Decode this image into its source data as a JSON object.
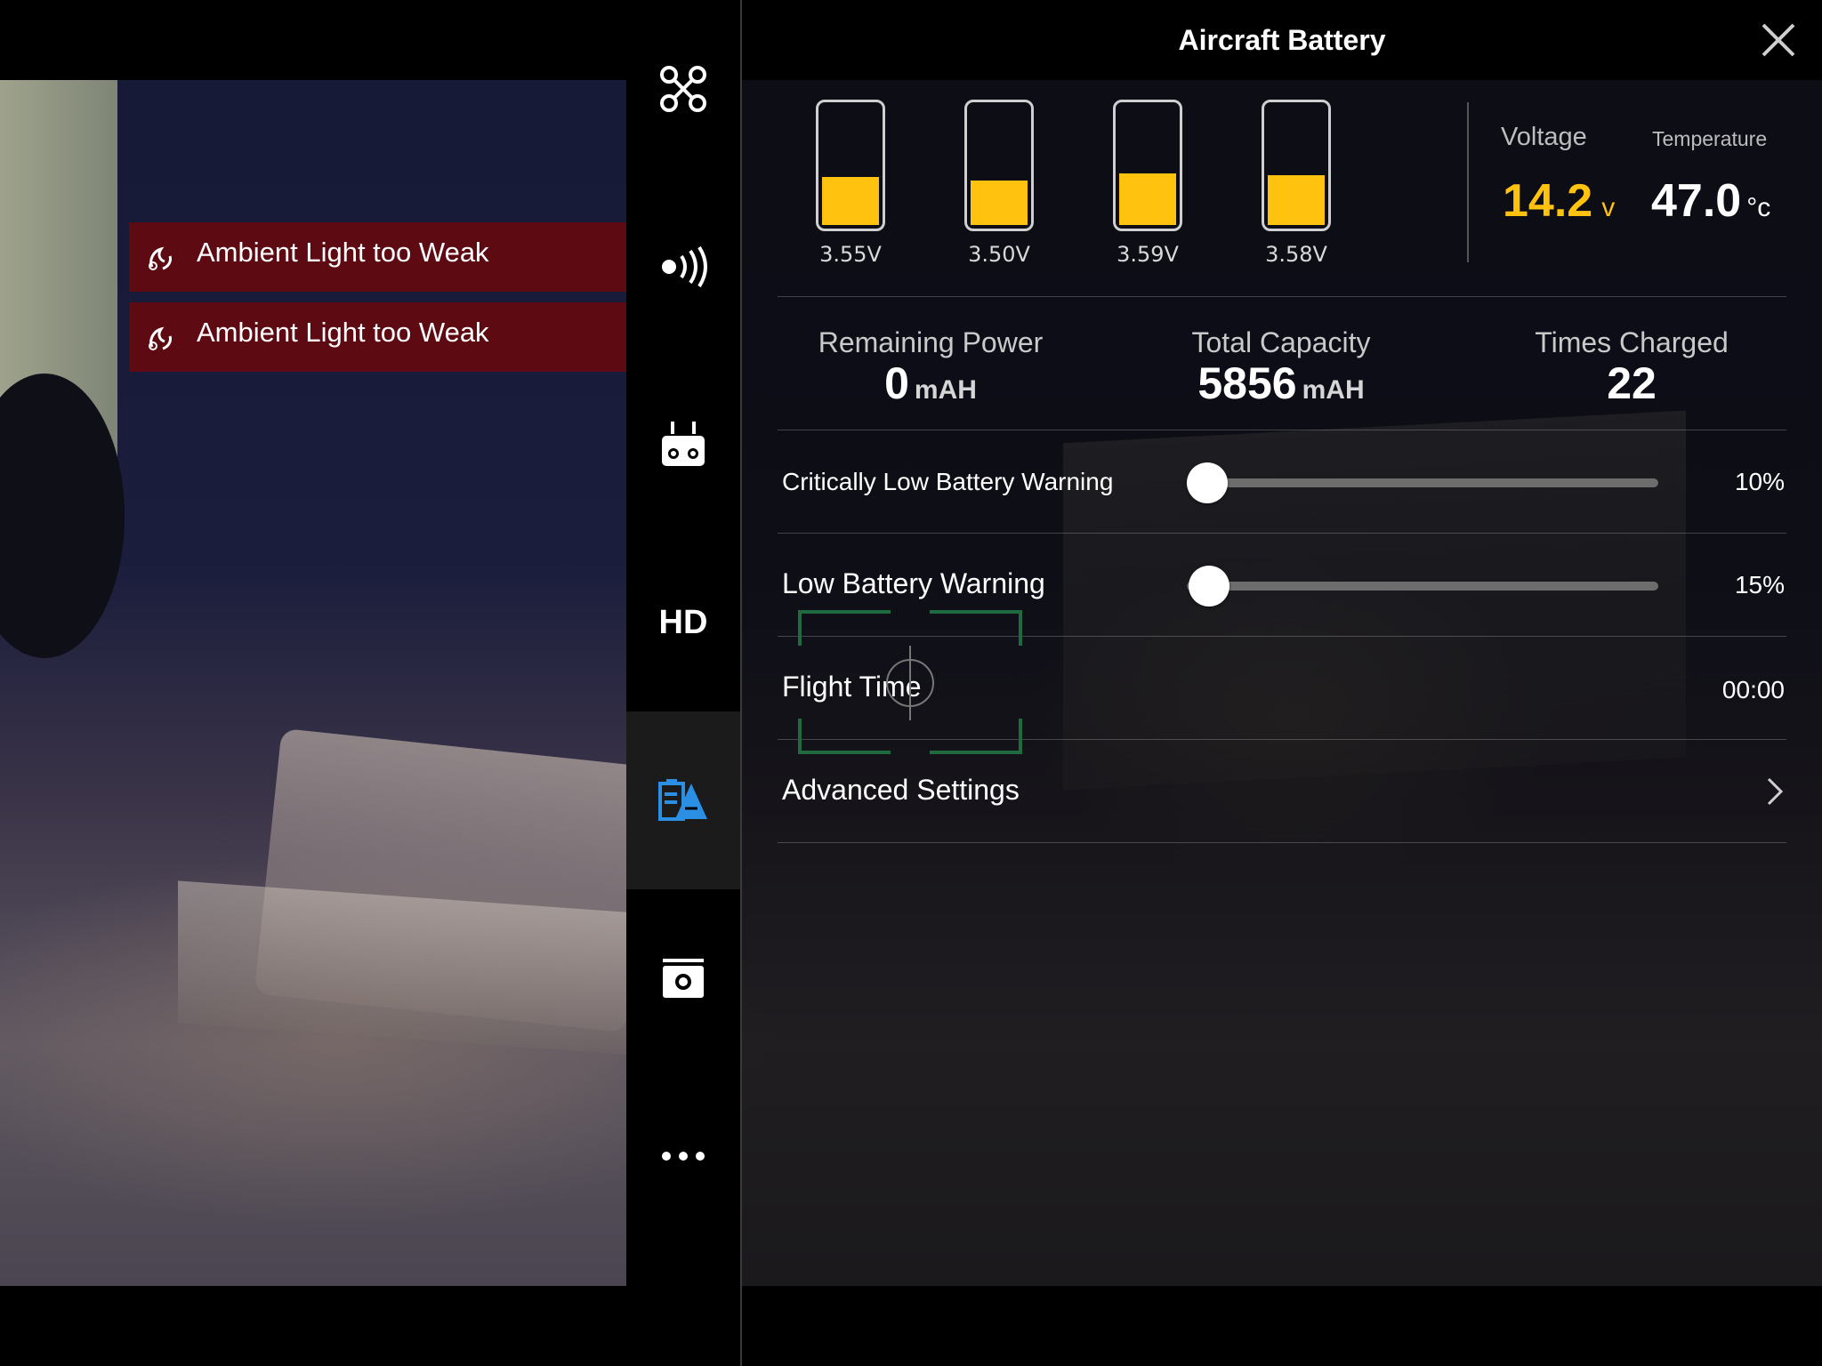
{
  "panel": {
    "title": "Aircraft Battery"
  },
  "cells": [
    {
      "voltage": "3.55V",
      "level": 0.4
    },
    {
      "voltage": "3.50V",
      "level": 0.37
    },
    {
      "voltage": "3.59V",
      "level": 0.43
    },
    {
      "voltage": "3.58V",
      "level": 0.42
    }
  ],
  "voltage": {
    "label": "Voltage",
    "value": "14.2",
    "unit": "v"
  },
  "temperature": {
    "label": "Temperature",
    "value": "47.0",
    "unit": "°c"
  },
  "stats": {
    "remaining_power": {
      "label": "Remaining Power",
      "value": "0",
      "unit": "mAH"
    },
    "total_capacity": {
      "label": "Total Capacity",
      "value": "5856",
      "unit": "mAH"
    },
    "times_charged": {
      "label": "Times Charged",
      "value": "22"
    }
  },
  "settings": {
    "critical_low": {
      "label": "Critically Low Battery Warning",
      "value": "10%",
      "percent": 10
    },
    "low": {
      "label": "Low Battery Warning",
      "value": "15%",
      "percent": 15
    },
    "flight_time": {
      "label": "Flight Time",
      "value": "00:00"
    },
    "advanced": {
      "label": "Advanced Settings"
    }
  },
  "sidebar": {
    "items": [
      {
        "name": "aircraft",
        "icon": "drone-icon"
      },
      {
        "name": "signal",
        "icon": "signal-icon"
      },
      {
        "name": "remote",
        "icon": "remote-controller-icon"
      },
      {
        "name": "hd",
        "icon": "hd-label",
        "label": "HD"
      },
      {
        "name": "battery",
        "icon": "battery-icon",
        "active": true
      },
      {
        "name": "camera",
        "icon": "camera-icon"
      },
      {
        "name": "more",
        "icon": "more-icon"
      }
    ]
  },
  "alerts": [
    {
      "text": "Ambient Light too Weak",
      "close": "×"
    },
    {
      "text": "Ambient Light too Weak",
      "close": "×"
    }
  ],
  "reticle": {
    "label": "AF"
  },
  "colors": {
    "accent_yellow": "#ffc20e",
    "active_blue": "#2b8fe3",
    "alert_red": "#5e0a12",
    "focus_green": "#1f6b3f"
  }
}
